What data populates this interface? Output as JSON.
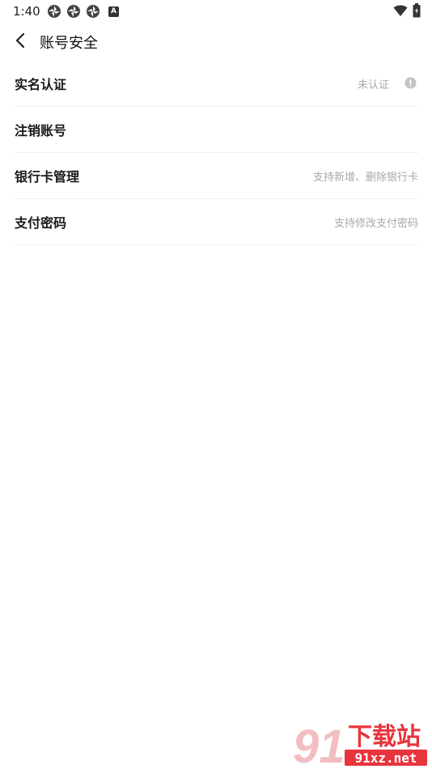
{
  "status_bar": {
    "time": "1:40",
    "notification_icons": [
      "pinwheel-icon",
      "pinwheel-icon",
      "pinwheel-icon",
      "app-a-icon"
    ],
    "app_a_letter": "A",
    "right_icons": [
      "wifi-icon",
      "battery-icon"
    ]
  },
  "header": {
    "title": "账号安全"
  },
  "settings": {
    "items": [
      {
        "label": "实名认证",
        "hint": "未认证",
        "icon": "info-icon"
      },
      {
        "label": "注销账号",
        "hint": ""
      },
      {
        "label": "银行卡管理",
        "hint": "支持新增、删除银行卡"
      },
      {
        "label": "支付密码",
        "hint": "支持修改支付密码"
      }
    ]
  },
  "watermark": {
    "logo_text": "91",
    "brand_text": "下载站",
    "domain": "91xz.net",
    "colors": {
      "red": "#e8343c",
      "pink": "#f2b8bb"
    }
  }
}
